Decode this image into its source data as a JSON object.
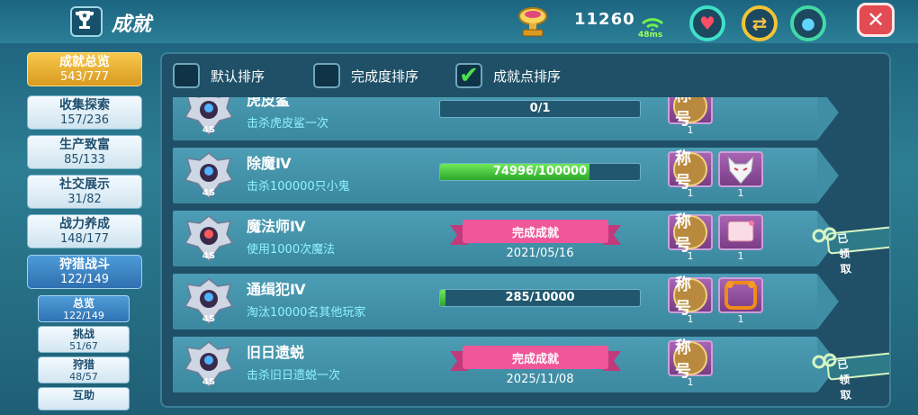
{
  "header": {
    "title": "成就",
    "points": "11260",
    "ping": "48ms",
    "close_symbol": "✕"
  },
  "sidebar": {
    "items": [
      {
        "label": "成就总览",
        "count": "543/777"
      },
      {
        "label": "收集探索",
        "count": "157/236"
      },
      {
        "label": "生产致富",
        "count": "85/133"
      },
      {
        "label": "社交展示",
        "count": "31/82"
      },
      {
        "label": "战力养成",
        "count": "148/177"
      },
      {
        "label": "狩猎战斗",
        "count": "122/149"
      }
    ],
    "subitems": [
      {
        "label": "总览",
        "count": "122/149"
      },
      {
        "label": "挑战",
        "count": "51/67"
      },
      {
        "label": "狩猎",
        "count": "48/57"
      },
      {
        "label": "互助",
        "count": ""
      }
    ]
  },
  "sort": {
    "default_label": "默认排序",
    "completion_label": "完成度排序",
    "points_label": "成就点排序",
    "checked": "points",
    "check_symbol": "✔"
  },
  "achievements": [
    {
      "name": "虎皮鲨",
      "desc": "击杀虎皮鲨一次",
      "progress": "0/1",
      "progress_value": 0,
      "reward_label": "称号",
      "reward_qty": "1"
    },
    {
      "name": "除魔Ⅳ",
      "desc": "击杀100000只小鬼",
      "progress": "74996/100000",
      "progress_value": 0.74996,
      "reward_label": "称号",
      "reward_qty": "1",
      "reward2_qty": "1"
    },
    {
      "name": "魔法师Ⅳ",
      "desc": "使用1000次魔法",
      "status": "完成成就",
      "date": "2021/05/16",
      "reward_label": "称号",
      "reward_qty": "1",
      "reward2_qty": "1",
      "claimed": "已领取"
    },
    {
      "name": "通缉犯Ⅳ",
      "desc": "淘汰10000名其他玩家",
      "progress": "285/10000",
      "progress_value": 0.0285,
      "reward_label": "称号",
      "reward_qty": "1",
      "reward2_qty": "1"
    },
    {
      "name": "旧日遗蜕",
      "desc": "击杀旧日遗蜕一次",
      "status": "完成成就",
      "date": "2025/11/08",
      "reward_label": "称号",
      "reward_qty": "1",
      "claimed": "已领取"
    }
  ],
  "badge_text": "4S",
  "colors": {
    "accent": "#4ee14b",
    "ribbon": "#f0569a",
    "gold": "#f4c24a"
  }
}
